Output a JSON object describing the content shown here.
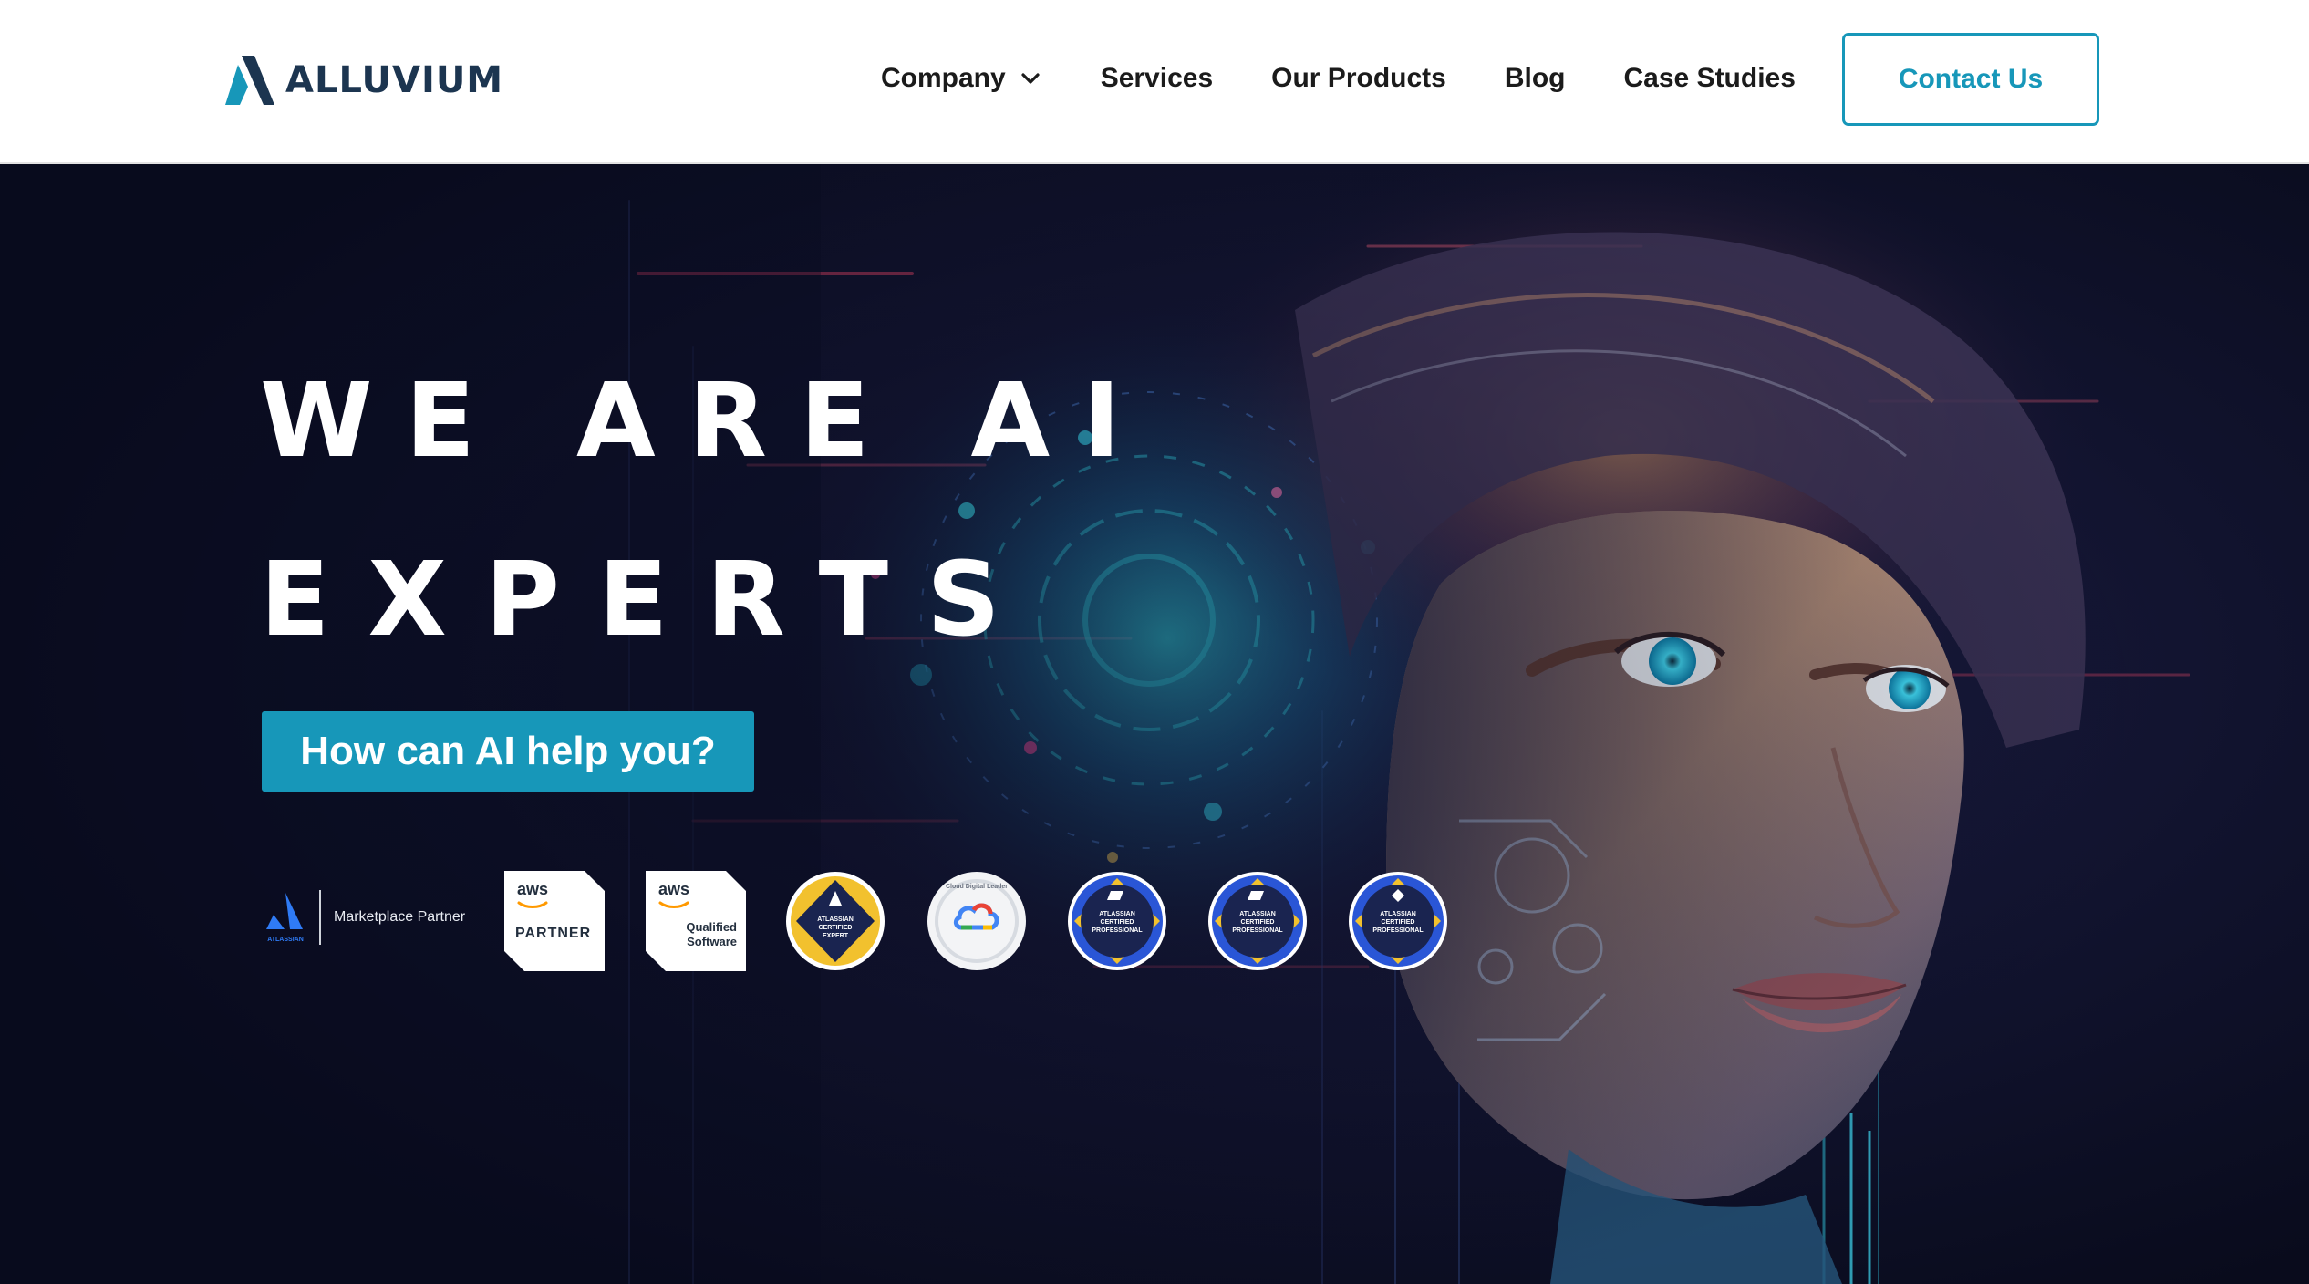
{
  "header": {
    "logo_text": "ALLUVIUM",
    "logo_icon": "alluvium-a-icon",
    "nav": [
      {
        "label": "Company",
        "has_dropdown": true
      },
      {
        "label": "Services"
      },
      {
        "label": "Our Products"
      },
      {
        "label": "Blog"
      },
      {
        "label": "Case Studies"
      }
    ],
    "contact_label": "Contact Us"
  },
  "hero": {
    "headline_line1": "WE ARE AI",
    "headline_line2": "EXPERTS",
    "cta_label": "How can AI help you?",
    "background": "digital-ai-face-image",
    "badges": {
      "marketplace": {
        "brand": "ATLASSIAN",
        "label": "Marketplace Partner"
      },
      "aws_partner": {
        "logo": "aws",
        "text": "PARTNER"
      },
      "aws_qualified": {
        "logo": "aws",
        "text1": "Qualified",
        "text2": "Software"
      },
      "atlassian_expert": {
        "line1": "ATLASSIAN",
        "line2": "CERTIFIED",
        "line3": "EXPERT"
      },
      "google_cloud": {
        "label": "Cloud Digital Leader"
      },
      "atlassian_pro_1": {
        "line1": "ATLASSIAN",
        "line2": "CERTIFIED",
        "line3": "PROFESSIONAL"
      },
      "atlassian_pro_2": {
        "line1": "ATLASSIAN",
        "line2": "CERTIFIED",
        "line3": "PROFESSIONAL"
      },
      "atlassian_pro_3": {
        "line1": "ATLASSIAN",
        "line2": "CERTIFIED",
        "line3": "PROFESSIONAL"
      }
    }
  },
  "colors": {
    "brand_teal": "#1797b9",
    "navy_text": "#1c3550",
    "hero_bg": "#0b0e22"
  }
}
